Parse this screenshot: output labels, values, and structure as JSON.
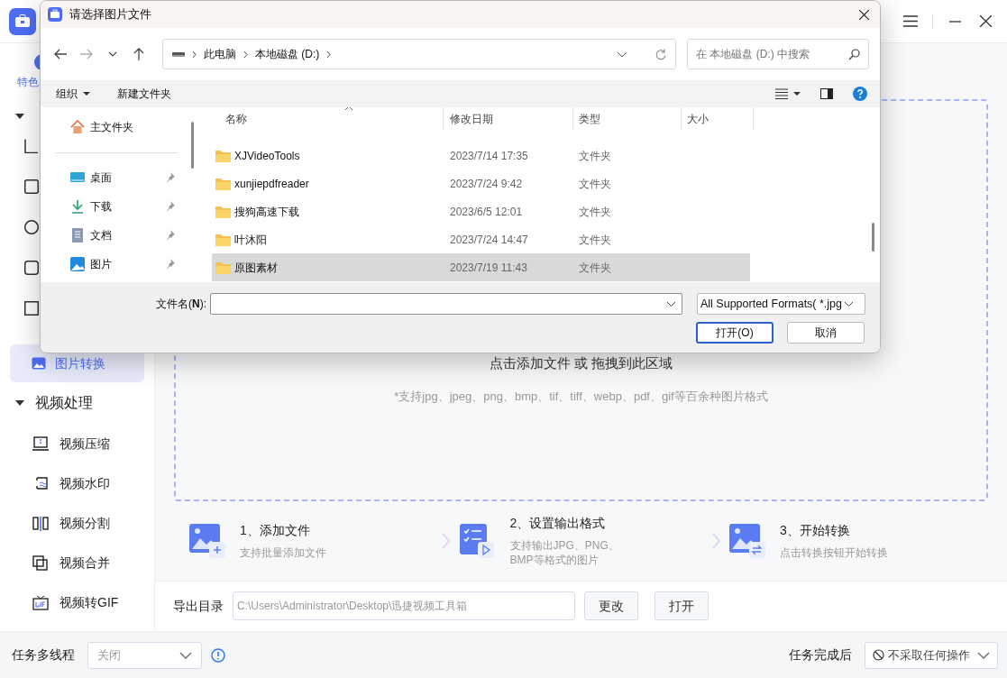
{
  "app": {
    "top_tab": {
      "label": "特色",
      "selected": true
    },
    "sidebar": {
      "active_item": {
        "label": "图片转换",
        "selected": true
      },
      "section": {
        "label": "视频处理",
        "expanded": true
      },
      "items": [
        {
          "label": "视频压缩",
          "kind": "compress"
        },
        {
          "label": "视频水印",
          "kind": "watermark"
        },
        {
          "label": "视频分割",
          "kind": "split"
        },
        {
          "label": "视频合并",
          "kind": "merge"
        },
        {
          "label": "视频转GIF",
          "kind": "gif"
        }
      ]
    },
    "drop_zone": {
      "title": "点击添加文件 或 拖拽到此区域",
      "hint": "*支持jpg、jpeg、png、bmp、tif、tiff、webp、pdf、gif等百余种图片格式"
    },
    "steps": [
      {
        "title": "1、添加文件",
        "desc": "支持批量添加文件",
        "kind": "add"
      },
      {
        "title": "2、设置输出格式",
        "desc": "支持输出JPG、PNG、BMP等格式的图片",
        "kind": "format"
      },
      {
        "title": "3、开始转换",
        "desc": "点击转换按钮开始转换",
        "kind": "convert"
      }
    ],
    "export": {
      "label": "导出目录",
      "path": "C:\\Users\\Administrator\\Desktop\\迅捷视频工具箱",
      "buttons": [
        "更改",
        "打开"
      ]
    },
    "status_bar": {
      "multithread_label": "任务多线程",
      "multithread_value": "关闭",
      "after_label": "任务完成后",
      "after_value": "不采取任何操作"
    }
  },
  "dialog": {
    "title": "请选择图片文件",
    "breadcrumb": [
      "此电脑",
      "本地磁盘 (D:)"
    ],
    "search": {
      "placeholder": "在 本地磁盘 (D:) 中搜索"
    },
    "toolbar": [
      "组织",
      "新建文件夹"
    ],
    "nav": [
      {
        "label": "主文件夹",
        "kind": "home",
        "pinned": false
      },
      {
        "label": "桌面",
        "kind": "desktop",
        "pinned": true
      },
      {
        "label": "下载",
        "kind": "download",
        "pinned": true
      },
      {
        "label": "文档",
        "kind": "docs",
        "pinned": true
      },
      {
        "label": "图片",
        "kind": "pictures",
        "pinned": true
      }
    ],
    "columns": [
      "名称",
      "修改日期",
      "类型",
      "大小"
    ],
    "rows": [
      {
        "name": "XJVideoTools",
        "date": "2023/7/14 17:35",
        "type": "文件夹",
        "selected": false
      },
      {
        "name": "xunjiepdfreader",
        "date": "2023/7/24 9:42",
        "type": "文件夹",
        "selected": false
      },
      {
        "name": "搜狗高速下载",
        "date": "2023/6/5 12:01",
        "type": "文件夹",
        "selected": false
      },
      {
        "name": "叶沐阳",
        "date": "2023/7/24 14:47",
        "type": "文件夹",
        "selected": false
      },
      {
        "name": "原图素材",
        "date": "2023/7/19 11:43",
        "type": "文件夹",
        "selected": true
      }
    ],
    "filename_label": "文件名(**N**):",
    "filter": "All Supported Formats( *.jpg",
    "buttons": [
      "打开(O)",
      "取消"
    ]
  }
}
